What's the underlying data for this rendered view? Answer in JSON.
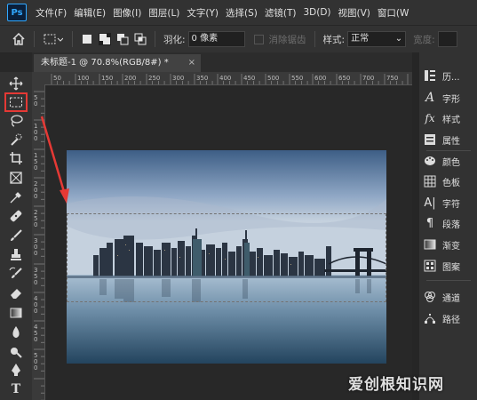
{
  "app": {
    "logo": "Ps"
  },
  "menu": [
    "文件(F)",
    "编辑(E)",
    "图像(I)",
    "图层(L)",
    "文字(Y)",
    "选择(S)",
    "滤镜(T)",
    "3D(D)",
    "视图(V)",
    "窗口(W"
  ],
  "options": {
    "feather_label": "羽化:",
    "feather_value": "0 像素",
    "antialias_label": "消除锯齿",
    "style_label": "样式:",
    "style_value": "正常",
    "width_label": "宽度:"
  },
  "document": {
    "tab_title": "未标题-1 @ 70.8%(RGB/8#) *",
    "close_symbol": "×"
  },
  "tools": [
    {
      "name": "move-tool",
      "icon": "move-icon"
    },
    {
      "name": "rect-marquee-tool",
      "icon": "rect-marquee-icon",
      "active": true
    },
    {
      "name": "lasso-tool",
      "icon": "lasso-icon"
    },
    {
      "name": "quick-select-tool",
      "icon": "quick-select-icon"
    },
    {
      "name": "crop-tool",
      "icon": "crop-icon"
    },
    {
      "name": "frame-tool",
      "icon": "frame-icon"
    },
    {
      "name": "eyedropper-tool",
      "icon": "eyedropper-icon"
    },
    {
      "name": "healing-brush-tool",
      "icon": "bandage-icon"
    },
    {
      "name": "brush-tool",
      "icon": "brush-icon"
    },
    {
      "name": "clone-stamp-tool",
      "icon": "stamp-icon"
    },
    {
      "name": "history-brush-tool",
      "icon": "history-brush-icon"
    },
    {
      "name": "eraser-tool",
      "icon": "eraser-icon"
    },
    {
      "name": "gradient-tool",
      "icon": "gradient-icon"
    },
    {
      "name": "blur-tool",
      "icon": "drop-icon"
    },
    {
      "name": "dodge-tool",
      "icon": "dodge-icon"
    },
    {
      "name": "pen-tool",
      "icon": "pen-icon"
    },
    {
      "name": "type-tool",
      "icon": "type-icon"
    }
  ],
  "ruler": {
    "top_labels": [
      "50",
      "100",
      "150",
      "200",
      "250",
      "300",
      "350",
      "400",
      "450",
      "500",
      "550",
      "600",
      "650",
      "700",
      "750"
    ],
    "left_labels": [
      "5 0",
      "1 0 0",
      "1 5 0",
      "2 0 0",
      "2 5 0",
      "3 0 0",
      "3 5 0",
      "4 0 0",
      "4 5 0",
      "5 0 0"
    ]
  },
  "panels": [
    {
      "label": "历...",
      "icon": "history-icon"
    },
    {
      "label": "字形",
      "icon": "glyphs-icon"
    },
    {
      "label": "样式",
      "icon": "styles-icon"
    },
    {
      "label": "属性",
      "icon": "properties-icon"
    },
    {
      "label": "颜色",
      "icon": "color-palette-icon"
    },
    {
      "label": "色板",
      "icon": "swatches-icon"
    },
    {
      "label": "字符",
      "icon": "character-icon"
    },
    {
      "label": "段落",
      "icon": "paragraph-icon"
    },
    {
      "label": "渐变",
      "icon": "gradient-panel-icon"
    },
    {
      "label": "图案",
      "icon": "patterns-icon"
    },
    {
      "label": "通道",
      "icon": "channels-icon"
    },
    {
      "label": "路径",
      "icon": "paths-icon"
    }
  ],
  "watermark": "爱创根知识网",
  "colors": {
    "accent_red": "#e53935",
    "selection": "#ffffff"
  }
}
